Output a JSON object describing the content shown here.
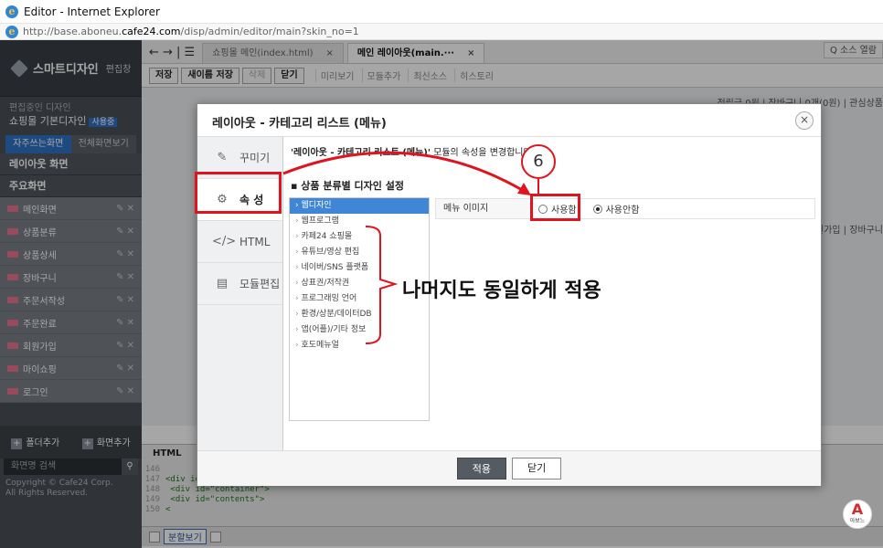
{
  "window": {
    "title": "Editor - Internet Explorer",
    "url_prefix": "http://base.aboneu.",
    "url_host": "cafe24.com",
    "url_suffix": "/disp/admin/editor/main?skin_no=1"
  },
  "sidebar": {
    "app_title": "스마트디자인",
    "app_subtitle": "편집창",
    "current_label": "편집중인 디자인",
    "current_name": "쇼핑몰 기본디자인",
    "current_badge": "사용중",
    "tabs": [
      "자주쓰는화면",
      "전체화면보기"
    ],
    "section_layout": "레이아웃 화면",
    "section_main": "주요화면",
    "items": [
      "메인화면",
      "상품분류",
      "상품상세",
      "장바구니",
      "주문서작성",
      "주문완료",
      "회원가입",
      "마이쇼핑",
      "로그인"
    ],
    "item_actions": "✎ ✕",
    "bottom_add": "폴더추가",
    "bottom_add2": "화면추가",
    "search_placeholder": "화면명 검색",
    "search_icon": "magnifier-icon",
    "copyright_1": "Copyright © Cafe24 Corp.",
    "copyright_2": "All Rights Reserved."
  },
  "editor": {
    "nav": "← → | ☰",
    "tabs": [
      {
        "label": "쇼핑몰 메인(index.html)"
      },
      {
        "label": "메인 레이아웃(main.···"
      }
    ],
    "source_view": "Q 소스 열람",
    "toolbar": {
      "save": "저장",
      "save_as": "새이름 저장",
      "delete": "삭제",
      "close": "닫기"
    },
    "toolbar_links": [
      "미리보기",
      "모듈추가",
      "최신소스",
      "히스토리"
    ],
    "member_bar": "적립금 0원 | 장바구니 0개(0원) | 관심상품",
    "member_bar2": "회원가입 | 장바구니",
    "html_label": "HTML",
    "code_lines": [
      {
        "n": "146",
        "text": ""
      },
      {
        "n": "147",
        "text": "<div id=\"wrap\">"
      },
      {
        "n": "148",
        "text": "    <div id=\"container\">"
      },
      {
        "n": "149",
        "text": "        <div id=\"contents\">"
      },
      {
        "n": "150",
        "text": "<"
      }
    ],
    "split_view": "분할보기",
    "watermark": "아보느"
  },
  "modal": {
    "title": "레이아웃 - 카테고리 리스트 (메뉴)",
    "close_icon": "close-icon",
    "side": [
      {
        "label": "꾸미기",
        "icon": "brush-icon"
      },
      {
        "label": "속 성",
        "icon": "properties-icon"
      },
      {
        "label": "HTML",
        "icon": "code-icon"
      },
      {
        "label": "모듈편집",
        "icon": "module-edit-icon"
      }
    ],
    "desc_bold": "'레이아웃 - 카테고리 리스트 (메뉴)'",
    "desc_rest": " 모듈의 속성을 변경합니다.",
    "sub_title": "상품 분류별 디자인 설정",
    "categories": [
      "웹디자인",
      "웹프로그램",
      "카페24 쇼핑몰",
      "유튜브/영상 편집",
      "네이버/SNS 플랫폼",
      "상표권/저작권",
      "프로그래밍 언어",
      "환경/상분/데이터DB",
      "앱(어플)/기타 정보",
      "호도메뉴얼"
    ],
    "prop_label": "메뉴 이미지",
    "radio_use": "사용함",
    "radio_nouse": "사용안함",
    "selected": "사용안함",
    "apply": "적용",
    "close": "닫기"
  },
  "annotation": {
    "step": "6",
    "text": "나머지도 동일하게 적용",
    "color": "#e0141e"
  }
}
